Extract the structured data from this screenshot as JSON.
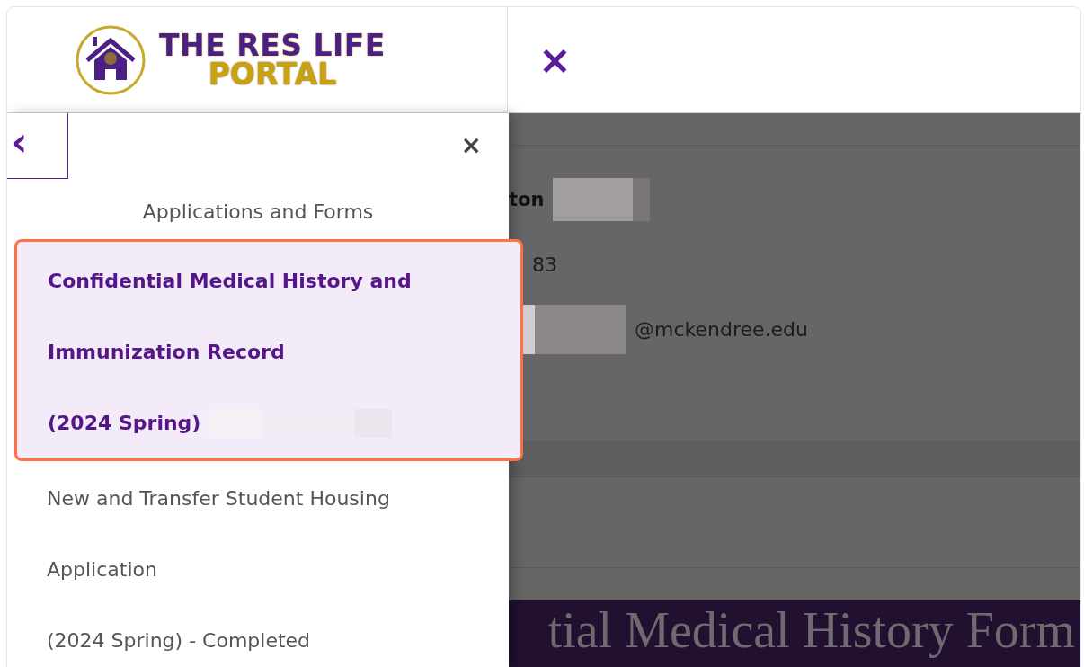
{
  "header": {
    "logo_line_1": "THE RES LIFE",
    "logo_line_2": "PORTAL",
    "close_label": "×"
  },
  "sidebar": {
    "back_label": "‹",
    "close_label": "×",
    "heading": "Applications and Forms",
    "items": [
      {
        "lines": [
          "Confidential Medical History and",
          "Immunization Record",
          "(2024 Spring)"
        ],
        "selected": true,
        "redacted": true
      },
      {
        "lines": [
          "New and Transfer Student Housing",
          "Application",
          "(2024 Spring) - Completed"
        ],
        "selected": false,
        "redacted": false
      }
    ]
  },
  "background": {
    "name_fragment": "ton",
    "phone_fragment": "83",
    "email_domain": "@mckendree.edu",
    "banner_title": "tial Medical History Form"
  }
}
